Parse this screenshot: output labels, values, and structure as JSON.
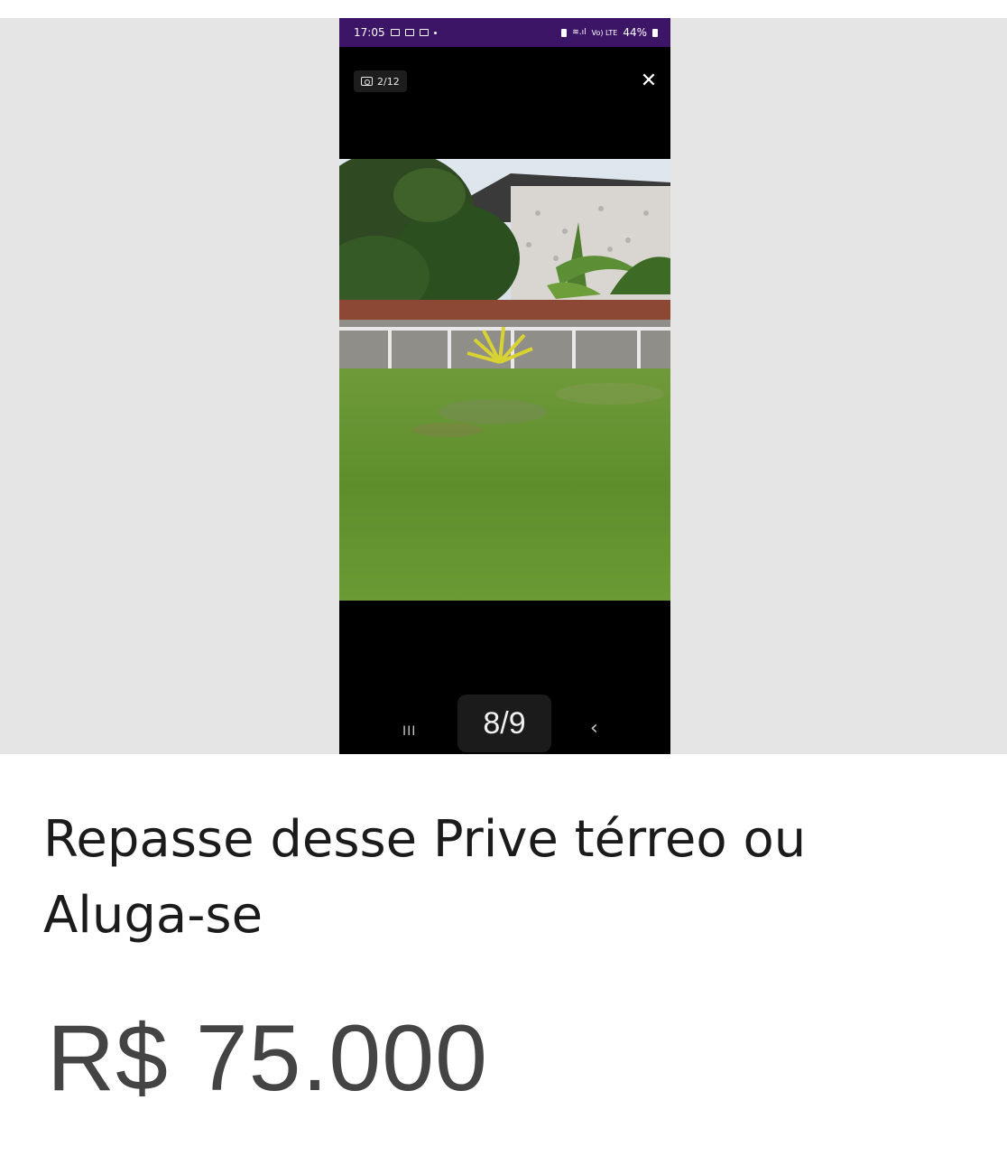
{
  "status_bar": {
    "time": "17:05",
    "network": "Vo) LTE",
    "battery": "44%"
  },
  "viewer": {
    "photo_counter": "2/12",
    "close_icon": "close-icon",
    "page_indicator": "8/9",
    "nav_recents": "III",
    "nav_back": "‹"
  },
  "photo": {
    "description_icon": "property-photo"
  },
  "listing": {
    "title": "Repasse desse Prive térreo ou Aluga-se",
    "price": "R$ 75.000"
  },
  "colors": {
    "status_bar": "#3c1567",
    "gallery_bg": "#e5e5e5",
    "price_text": "#444444"
  }
}
